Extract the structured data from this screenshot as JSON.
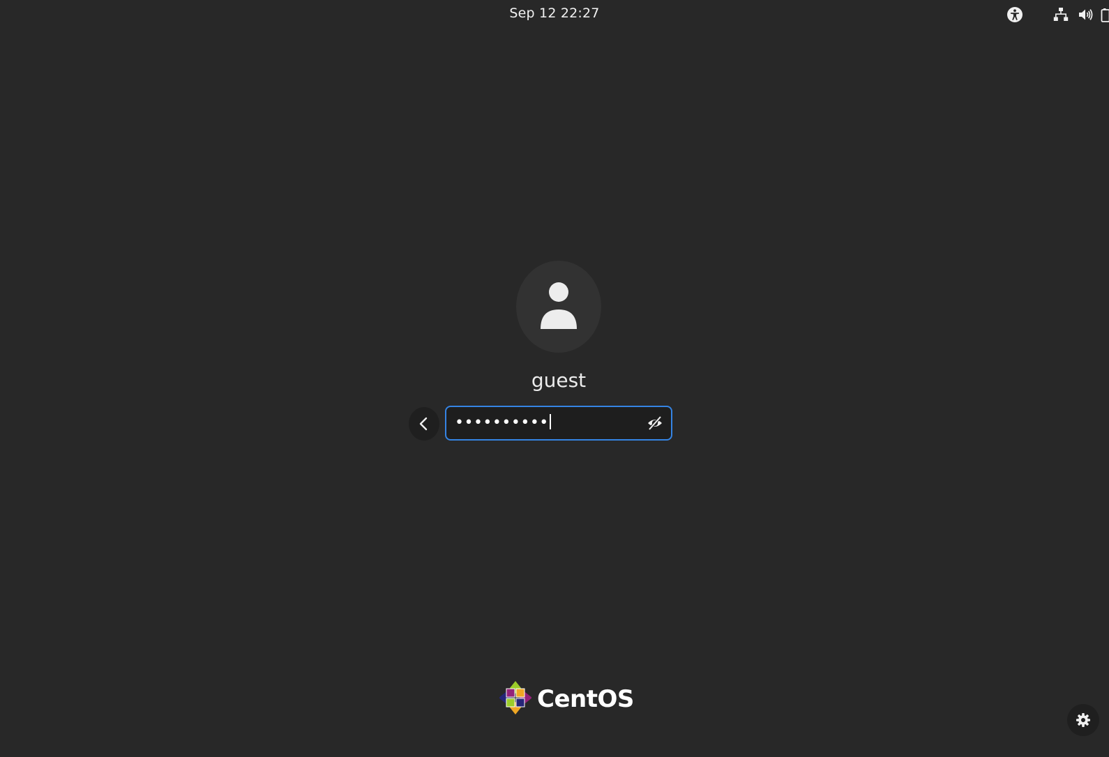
{
  "topbar": {
    "clock": "Sep 12  22:27",
    "tray_icons": [
      "accessibility-icon",
      "network-wired-icon",
      "volume-icon",
      "battery-icon"
    ]
  },
  "login": {
    "avatar_icon": "user-avatar-icon",
    "username": "guest",
    "password_masked": "••••••••••",
    "back_icon": "chevron-left-icon",
    "reveal_icon": "eye-slash-icon",
    "focus_color": "#3584e4"
  },
  "branding": {
    "logo_text": "CentOS",
    "logo_icon": "centos-logo-icon"
  },
  "settings": {
    "icon": "gear-icon"
  },
  "colors": {
    "background": "#282828",
    "accent": "#3584e4"
  }
}
